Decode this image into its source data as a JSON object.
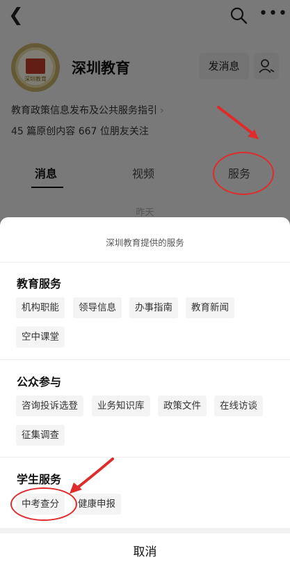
{
  "account": {
    "name": "深圳教育",
    "avatar_text": "深圳教育",
    "description": "教育政策信息发布及公共服务指引",
    "stats": "45 篇原创内容  667 位朋友关注",
    "send_message_label": "发消息"
  },
  "tabs": [
    {
      "label": "消息"
    },
    {
      "label": "视频"
    },
    {
      "label": "服务"
    }
  ],
  "date_hint": "昨天",
  "sheet": {
    "title": "深圳教育提供的服务",
    "sections": [
      {
        "title": "教育服务",
        "items": [
          "机构职能",
          "领导信息",
          "办事指南",
          "教育新闻",
          "空中课堂"
        ]
      },
      {
        "title": "公众参与",
        "items": [
          "咨询投诉选登",
          "业务知识库",
          "政策文件",
          "在线访谈",
          "征集调查"
        ]
      },
      {
        "title": "学生服务",
        "items": [
          "中考查分",
          "健康申报"
        ]
      }
    ],
    "cancel_label": "取消"
  },
  "colors": {
    "annotation_red": "#e02b2b",
    "chip_bg": "#f4f4f4",
    "overlay": "rgba(0,0,0,0.5)"
  },
  "icons": [
    "back-icon",
    "search-icon",
    "more-icon",
    "profile-icon",
    "chevron-right-icon"
  ]
}
